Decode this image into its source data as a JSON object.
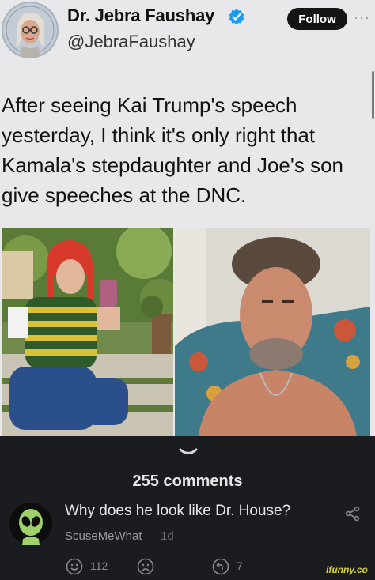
{
  "tweet": {
    "display_name": "Dr. Jebra Faushay",
    "handle": "@JebraFaushay",
    "follow_label": "Follow",
    "more_icon": "more-horizontal-icon",
    "text": "After seeing Kai Trump's speech yesterday, I think it's only right that Kamala's stepdaughter and Joe's son give speeches at the DNC.",
    "verified_color": "#1d9bf0"
  },
  "comments": {
    "count_label": "255 comments",
    "items": [
      {
        "text": "Why does he look like Dr. House?",
        "username": "ScuseMeWhat",
        "time": "1d",
        "likes": "112",
        "replies": "7"
      }
    ]
  },
  "watermark": "ifunny.co",
  "colors": {
    "panel_bg": "#1b1c20",
    "card_bg": "#e8e8ea",
    "watermark": "#d8d030"
  }
}
